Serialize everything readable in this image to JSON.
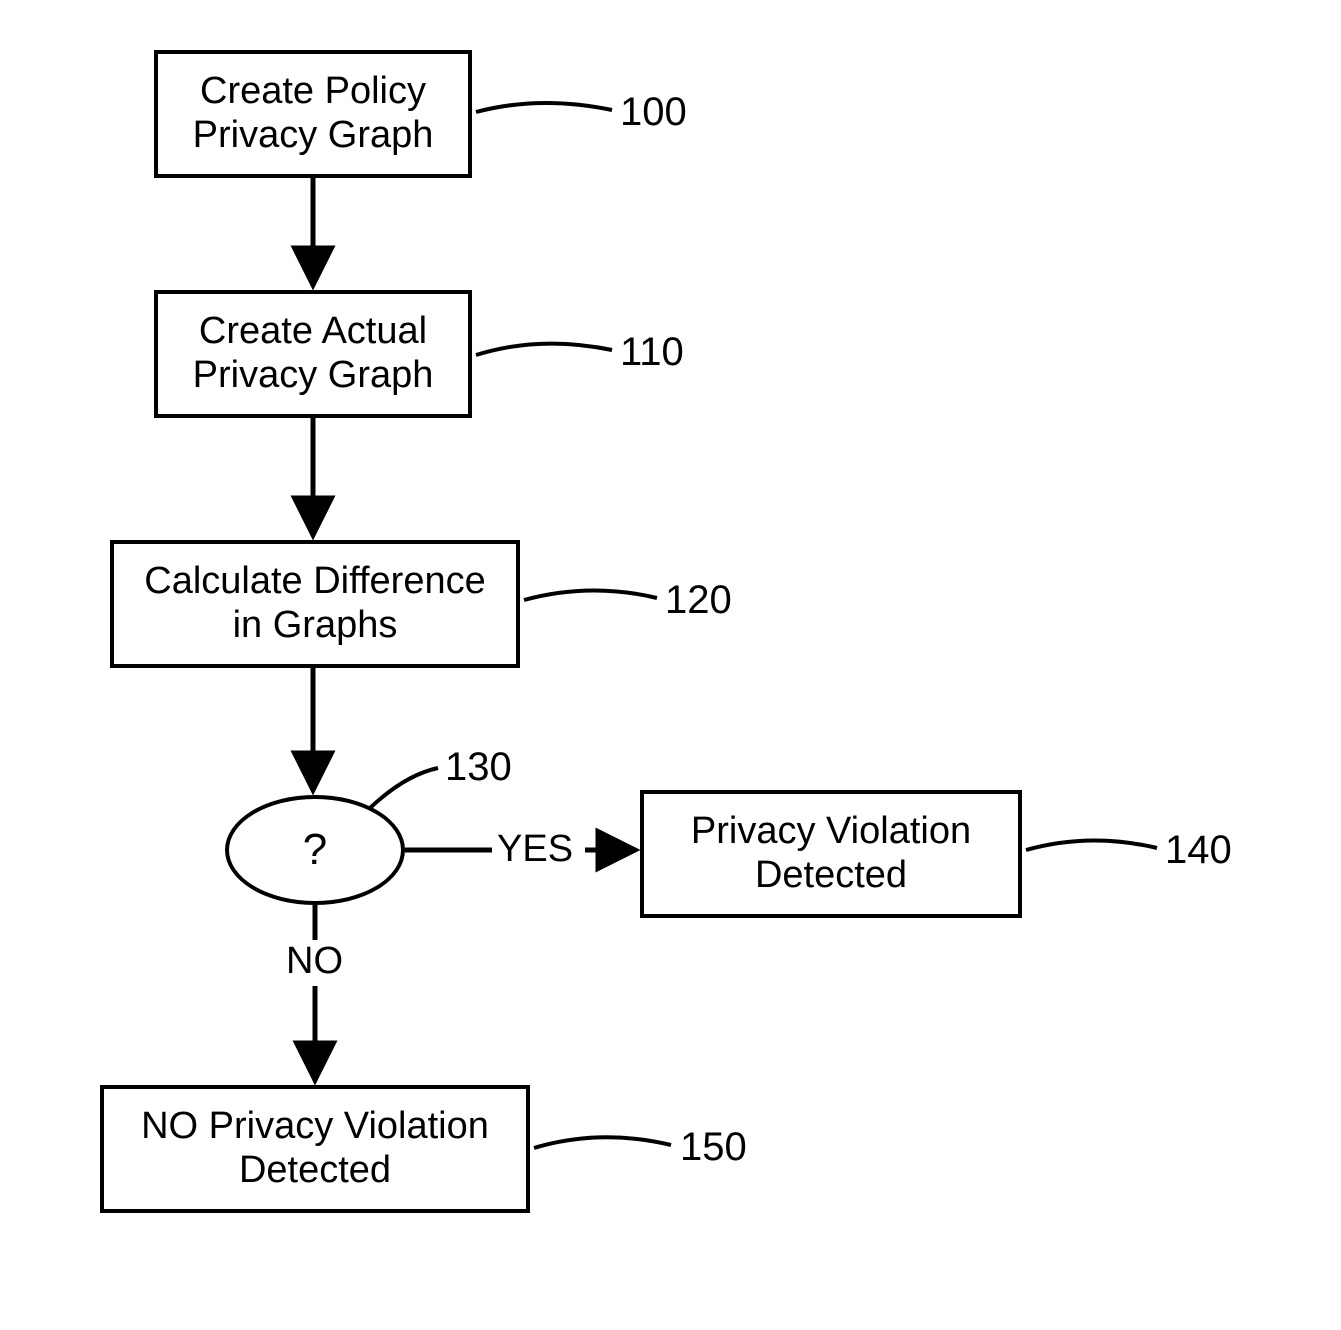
{
  "boxes": {
    "b100": {
      "line1": "Create Policy",
      "line2": "Privacy Graph"
    },
    "b110": {
      "line1": "Create Actual",
      "line2": "Privacy Graph"
    },
    "b120": {
      "line1": "Calculate Difference",
      "line2": "in Graphs"
    },
    "b140": {
      "line1": "Privacy Violation",
      "line2": "Detected"
    },
    "b150": {
      "line1": "NO Privacy Violation",
      "line2": "Detected"
    }
  },
  "decision": {
    "q": "?"
  },
  "labels": {
    "n100": "100",
    "n110": "110",
    "n120": "120",
    "n130": "130",
    "n140": "140",
    "n150": "150",
    "yes": "YES",
    "no": "NO"
  }
}
